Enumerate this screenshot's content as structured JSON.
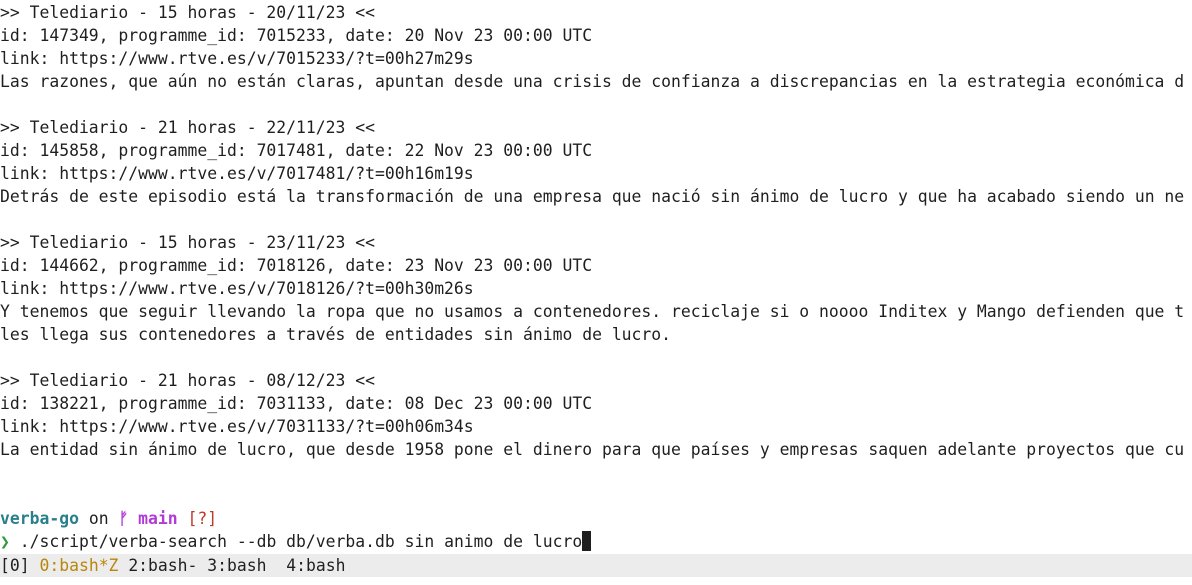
{
  "results": [
    {
      "header": ">> Telediario - 15 horas - 20/11/23 <<",
      "meta": "id: 147349, programme_id: 7015233, date: 20 Nov 23 00:00 UTC",
      "link": "link: https://www.rtve.es/v/7015233/?t=00h27m29s",
      "text": [
        "Las razones, que aún no están claras, apuntan desde una crisis de confianza a discrepancias en la estrategia económica d"
      ]
    },
    {
      "header": ">> Telediario - 21 horas - 22/11/23 <<",
      "meta": "id: 145858, programme_id: 7017481, date: 22 Nov 23 00:00 UTC",
      "link": "link: https://www.rtve.es/v/7017481/?t=00h16m19s",
      "text": [
        "Detrás de este episodio está la transformación de una empresa que nació sin ánimo de lucro y que ha acabado siendo un ne"
      ]
    },
    {
      "header": ">> Telediario - 15 horas - 23/11/23 <<",
      "meta": "id: 144662, programme_id: 7018126, date: 23 Nov 23 00:00 UTC",
      "link": "link: https://www.rtve.es/v/7018126/?t=00h30m26s",
      "text": [
        "Y tenemos que seguir llevando la ropa que no usamos a contenedores. reciclaje si o noooo Inditex y Mango defienden que t",
        "les llega sus contenedores a través de entidades sin ánimo de lucro."
      ]
    },
    {
      "header": ">> Telediario - 21 horas - 08/12/23 <<",
      "meta": "id: 138221, programme_id: 7031133, date: 08 Dec 23 00:00 UTC",
      "link": "link: https://www.rtve.es/v/7031133/?t=00h06m34s",
      "text": [
        "La entidad sin ánimo de lucro, que desde 1958 pone el dinero para que países y empresas saquen adelante proyectos que cu"
      ]
    }
  ],
  "prompt": {
    "dir": "verba-go",
    "on": "on",
    "git_icon": "ᚠ",
    "branch": "main",
    "status": "[?]",
    "arrow": "❯",
    "command": "./script/verba-search --db db/verba.db sin animo de lucro"
  },
  "tmux": {
    "session": "[0]",
    "windows": [
      {
        "label": "0:bash*Z",
        "active": true
      },
      {
        "label": "2:bash-",
        "active": false
      },
      {
        "label": "3:bash",
        "active": false
      },
      {
        "label": "4:bash",
        "active": false
      }
    ]
  },
  "colors": {
    "background": "#ffffff",
    "prompt_dir": "#2a7f8c",
    "branch": "#b23ad6",
    "status": "#c0392b",
    "arrow": "#2d9a3c",
    "statusbar_bg": "#ececec",
    "active_window": "#b8860b"
  }
}
